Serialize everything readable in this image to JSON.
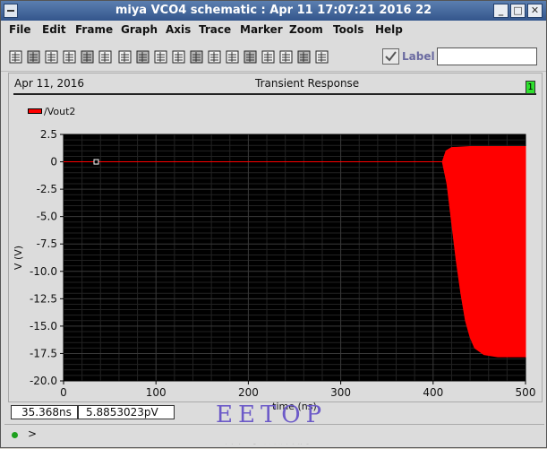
{
  "window": {
    "title": "miya VCO4 schematic : Apr 11 17:07:21 2016 22"
  },
  "menu": [
    "File",
    "Edit",
    "Frame",
    "Graph",
    "Axis",
    "Trace",
    "Marker",
    "Zoom",
    "Tools",
    "Help"
  ],
  "toolbar": {
    "icons": [
      "print-icon",
      "line-icon",
      "grid-icon",
      "list-icon",
      "frame-icon",
      "split-icon",
      "copy-icon",
      "graph-icon",
      "export-icon",
      "marker-icon",
      "pattern-icon",
      "mesh-icon",
      "hatch-icon",
      "calculator-icon",
      "zoom-fit-icon",
      "zoom-vertical-icon",
      "zoom-horizontal-icon",
      "zoom-full-icon"
    ],
    "label_text": "Label",
    "label_value": ""
  },
  "plot": {
    "date": "Apr 11, 2016",
    "title": "Transient Response",
    "badge": "1",
    "legend": "/Vout2"
  },
  "status": {
    "x_readout": "35.368ns",
    "y_readout": "5.8853023pV"
  },
  "watermark": {
    "main": "EETOP",
    "sub": "中国电子顶级开发网"
  },
  "cmd": {
    "prompt": ">"
  },
  "colors": {
    "trace": "#ff0000",
    "plot_bg": "#000000",
    "grid": "#3a3a3a"
  },
  "chart_data": {
    "type": "line",
    "title": "Transient Response",
    "xlabel": "time (ns)",
    "ylabel": "V (V)",
    "xlim": [
      0,
      500
    ],
    "ylim": [
      -20,
      2.5
    ],
    "x_ticks": [
      0,
      100,
      200,
      300,
      400,
      500
    ],
    "y_ticks": [
      2.5,
      0,
      -2.5,
      -5.0,
      -7.5,
      -10.0,
      -12.5,
      -15.0,
      -17.5,
      -20.0
    ],
    "y_tick_labels": [
      "2.5",
      "0",
      "-2.5",
      "-5.0",
      "-7.5",
      "-10.0",
      "-12.5",
      "-15.0",
      "-17.5",
      "-20.0"
    ],
    "grid": true,
    "series": [
      {
        "name": "/Vout2",
        "color": "#ff0000",
        "flat_x": [
          0,
          410
        ],
        "flat_y": 0,
        "envelope_top": [
          [
            410,
            0
          ],
          [
            414,
            1.0
          ],
          [
            420,
            1.3
          ],
          [
            440,
            1.4
          ],
          [
            500,
            1.4
          ]
        ],
        "envelope_bottom": [
          [
            410,
            0
          ],
          [
            415,
            -2.0
          ],
          [
            420,
            -5.5
          ],
          [
            425,
            -9.0
          ],
          [
            430,
            -12.0
          ],
          [
            435,
            -14.5
          ],
          [
            440,
            -16.0
          ],
          [
            445,
            -17.0
          ],
          [
            455,
            -17.6
          ],
          [
            470,
            -17.8
          ],
          [
            500,
            -17.8
          ]
        ]
      }
    ],
    "marker": {
      "x": 35.368,
      "y": 0
    }
  }
}
